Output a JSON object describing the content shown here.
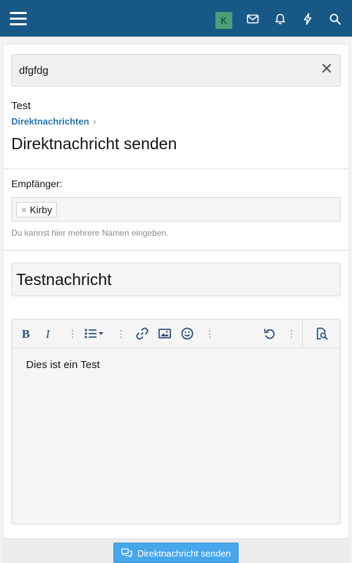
{
  "header": {
    "avatar_initial": "K",
    "icons": [
      "menu-icon",
      "envelope-icon",
      "bell-icon",
      "lightning-icon",
      "search-icon"
    ],
    "colors": {
      "bar": "#185886",
      "avatar": "#4c9e78"
    }
  },
  "notice": {
    "text": "dfgfdg",
    "close_glyph": "×"
  },
  "breadcrumb": {
    "context": "Test",
    "link": "Direktnachrichten",
    "chevron": "›"
  },
  "page": {
    "title": "Direktnachricht senden"
  },
  "recipients": {
    "label": "Empfänger:",
    "tokens": [
      {
        "name": "Kirby",
        "remove": "×"
      }
    ],
    "hint": "Du kannst hier mehrere Namen eingeben."
  },
  "form": {
    "title_value": "Testnachricht",
    "body_text": "Dies ist ein Test"
  },
  "toolbar": {
    "bold": "B",
    "italic": "I",
    "more": "⋮",
    "buttons": [
      "bold-icon",
      "italic-icon",
      "more-icon",
      "list-icon",
      "more-icon",
      "link-icon",
      "image-icon",
      "smiley-icon",
      "more-icon",
      "undo-icon",
      "more-icon",
      "preview-icon"
    ]
  },
  "submit": {
    "label": "Direktnachricht senden",
    "color": "#47a7eb"
  }
}
